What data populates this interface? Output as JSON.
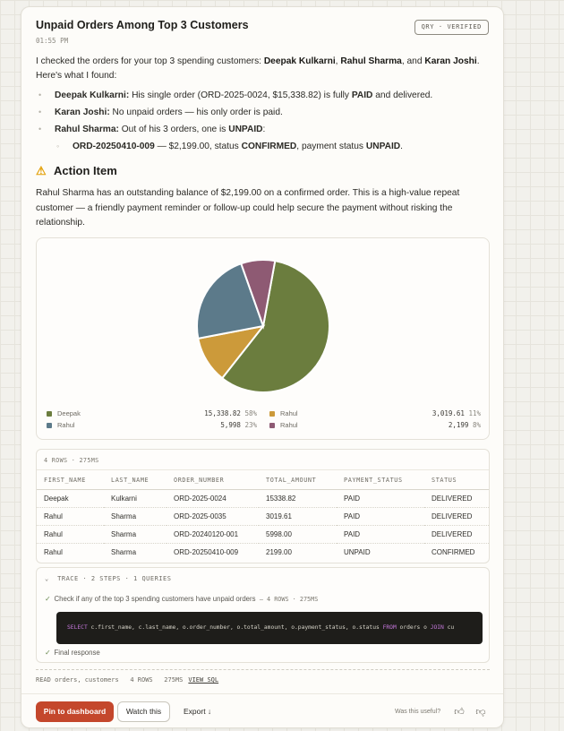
{
  "header": {
    "title": "Unpaid Orders Among Top 3 Customers",
    "time": "01:55 PM",
    "badge": "QRY · VERIFIED"
  },
  "intro": {
    "pre": "I checked the orders for your top 3 spending customers: ",
    "c1": "Deepak Kulkarni",
    "sep1": ", ",
    "c2": "Rahul Sharma",
    "sep2": ", and ",
    "c3": "Karan Joshi",
    "post": ". Here's what I found:"
  },
  "findings": [
    {
      "name": "Deepak Kulkarni:",
      "pre": " His single order (ORD-2025-0024, $15,338.82) is fully ",
      "bold": "PAID",
      "post": " and delivered."
    },
    {
      "name": "Karan Joshi:",
      "pre": " No unpaid orders — his only order is paid.",
      "bold": "",
      "post": ""
    },
    {
      "name": "Rahul Sharma:",
      "pre": " Out of his 3 orders, one is ",
      "bold": "UNPAID",
      "post": ":"
    }
  ],
  "sub_finding": {
    "order": "ORD-20250410-009",
    "pre": " — $2,199.00, status ",
    "status": "CONFIRMED",
    "mid": ", payment status ",
    "payment": "UNPAID",
    "post": "."
  },
  "action": {
    "icon": "⚠",
    "heading": "Action Item",
    "text": "Rahul Sharma has an outstanding balance of $2,199.00 on a confirmed order. This is a high-value repeat customer — a friendly payment reminder or follow-up could help secure the payment without risking the relationship."
  },
  "chart_data": {
    "type": "pie",
    "slices": [
      {
        "label": "Deepak",
        "value": 15338.82,
        "display": "15,338.82",
        "pct": "58%",
        "color": "#6b7d3e"
      },
      {
        "label": "Rahul",
        "value": 3019.61,
        "display": "3,019.61",
        "pct": "11%",
        "color": "#cc9a3a"
      },
      {
        "label": "Rahul",
        "value": 5998,
        "display": "5,998",
        "pct": "23%",
        "color": "#5c7a8a"
      },
      {
        "label": "Rahul",
        "value": 2199,
        "display": "2,199",
        "pct": "8%",
        "color": "#8e5a73"
      }
    ]
  },
  "table": {
    "meta": "4 ROWS · 275MS",
    "columns": [
      "FIRST_NAME",
      "LAST_NAME",
      "ORDER_NUMBER",
      "TOTAL_AMOUNT",
      "PAYMENT_STATUS",
      "STATUS"
    ],
    "rows": [
      [
        "Deepak",
        "Kulkarni",
        "ORD-2025-0024",
        "15338.82",
        "PAID",
        "DELIVERED"
      ],
      [
        "Rahul",
        "Sharma",
        "ORD-2025-0035",
        "3019.61",
        "PAID",
        "DELIVERED"
      ],
      [
        "Rahul",
        "Sharma",
        "ORD-20240120-001",
        "5998.00",
        "PAID",
        "DELIVERED"
      ],
      [
        "Rahul",
        "Sharma",
        "ORD-20250410-009",
        "2199.00",
        "UNPAID",
        "CONFIRMED"
      ]
    ]
  },
  "trace": {
    "header": "TRACE · 2 STEPS · 1 QUERIES",
    "step1": "Check if any of the top 3 spending customers have unpaid orders",
    "step1_meta": "— 4 ROWS · 275MS",
    "sql_kw1": "SELECT",
    "sql_body1": " c.first_name, c.last_name, o.order_number, o.total_amount, o.payment_status, o.status ",
    "sql_kw2": "FROM",
    "sql_body2": " orders o ",
    "sql_kw3": "JOIN",
    "sql_body3": " cu",
    "step2": "Final response"
  },
  "footer": {
    "meta": "READ orders, customers   4 ROWS   275MS",
    "view_sql": "VIEW SQL",
    "pin": "Pin to dashboard",
    "watch": "Watch this",
    "export": "Export ↓",
    "useful": "Was this useful?"
  }
}
